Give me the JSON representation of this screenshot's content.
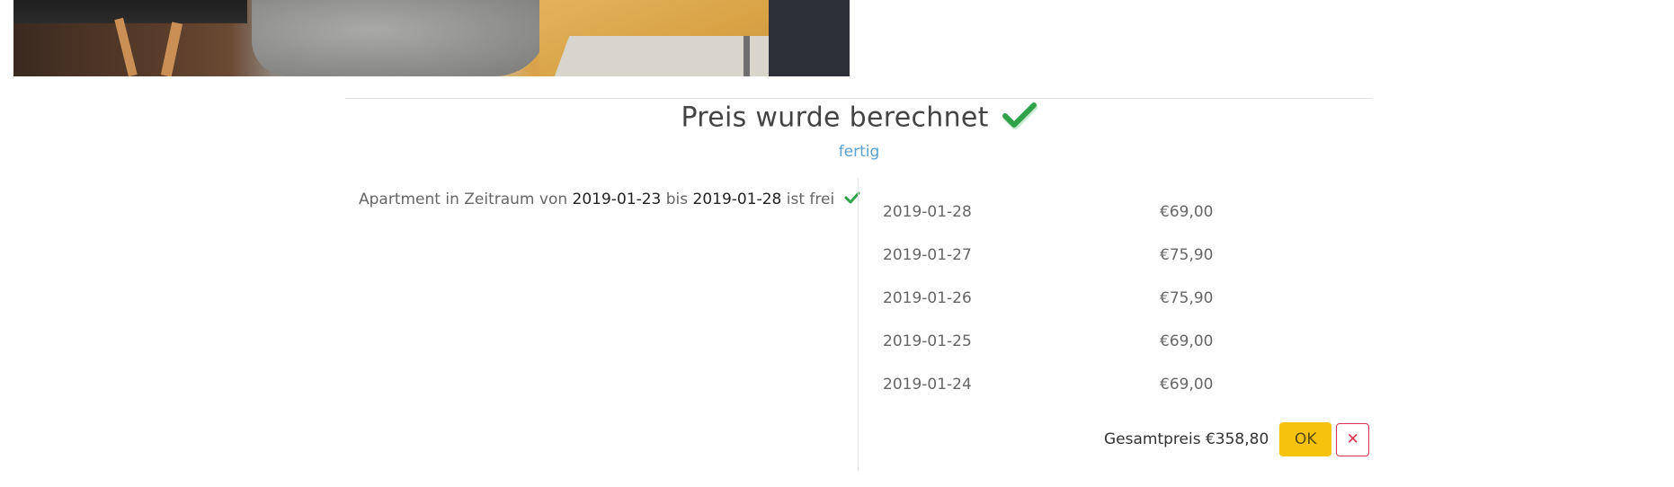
{
  "header": {
    "title": "Preis wurde berechnet",
    "status_link": "fertig"
  },
  "availability": {
    "prefix": "Apartment in Zeitraum von",
    "from": "2019-01-23",
    "middle": "bis",
    "to": "2019-01-28",
    "suffix": "ist frei"
  },
  "prices": [
    {
      "date": "2019-01-28",
      "price": "€69,00"
    },
    {
      "date": "2019-01-27",
      "price": "€75,90"
    },
    {
      "date": "2019-01-26",
      "price": "€75,90"
    },
    {
      "date": "2019-01-25",
      "price": "€69,00"
    },
    {
      "date": "2019-01-24",
      "price": "€69,00"
    }
  ],
  "total": {
    "label": "Gesamtpreis €358,80"
  },
  "actions": {
    "ok_label": "OK",
    "cancel_label": "✕"
  },
  "icons": {
    "title_check": "check-icon",
    "availability_check": "check-icon",
    "cancel": "close-icon"
  },
  "colors": {
    "check_green": "#2fa24a",
    "ok_yellow": "#f5c30d",
    "cancel_red": "#d9344f",
    "link_blue": "#5a9fd0"
  }
}
